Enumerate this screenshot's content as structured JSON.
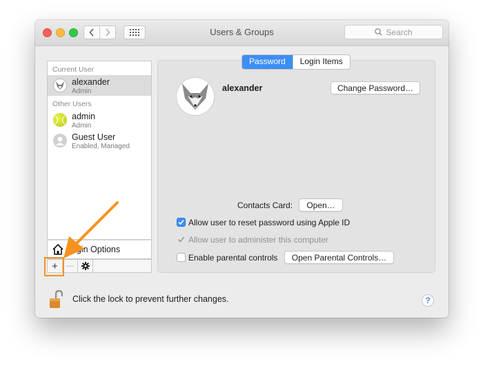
{
  "window": {
    "title": "Users & Groups"
  },
  "search": {
    "placeholder": "Search"
  },
  "sidebar": {
    "current_user_label": "Current User",
    "other_users_label": "Other Users",
    "users": [
      {
        "name": "alexander",
        "role": "Admin",
        "icon": "fox-avatar-icon",
        "selected": true
      },
      {
        "name": "admin",
        "role": "Admin",
        "icon": "tennis-ball-avatar-icon",
        "selected": false
      },
      {
        "name": "Guest User",
        "role": "Enabled, Managed",
        "icon": "person-silhouette-icon",
        "selected": false
      }
    ],
    "login_options_label": "Login Options",
    "toolbar": {
      "add": "+",
      "remove": "—"
    }
  },
  "tabs": [
    {
      "label": "Password",
      "active": true
    },
    {
      "label": "Login Items",
      "active": false
    }
  ],
  "main": {
    "username": "alexander",
    "change_password_label": "Change Password…",
    "contacts_card_label": "Contacts Card:",
    "open_button_label": "Open…",
    "allow_reset_label": "Allow user to reset password using Apple ID",
    "allow_reset_checked": true,
    "allow_admin_label": "Allow user to administer this computer",
    "allow_admin_checked": true,
    "parental_label": "Enable parental controls",
    "parental_checked": false,
    "open_parental_label": "Open Parental Controls…"
  },
  "footer": {
    "lock_text": "Click the lock to prevent further changes.",
    "help": "?"
  },
  "colors": {
    "accent": "#3d8ef6",
    "annotation": "#f7921e"
  }
}
